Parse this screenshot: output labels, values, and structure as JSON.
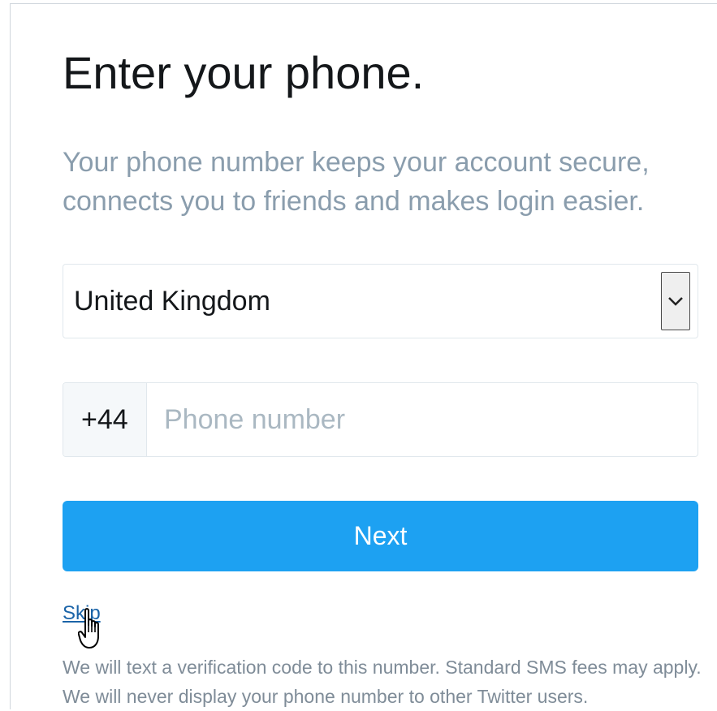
{
  "page": {
    "title": "Enter your phone.",
    "subtitle": "Your phone number keeps your account secure, connects you to friends and makes login easier."
  },
  "country_select": {
    "selected": "United Kingdom",
    "icon": "chevron-down-icon"
  },
  "phone": {
    "dial_code": "+44",
    "placeholder": "Phone number",
    "value": ""
  },
  "actions": {
    "next_label": "Next",
    "skip_label": "Skip"
  },
  "disclaimer": "We will text a verification code to this number. Standard SMS fees may apply. We will never display your phone number to other Twitter users.",
  "colors": {
    "accent": "#1da1f2",
    "link": "#1b64a8",
    "subtitle": "#8a9dad"
  },
  "cursor": {
    "icon": "hand-pointer-cursor-icon"
  }
}
